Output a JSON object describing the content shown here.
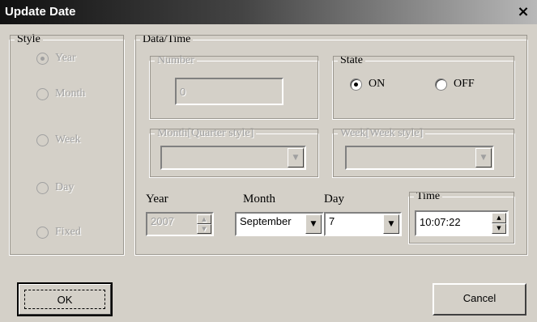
{
  "window": {
    "title": "Update Date",
    "close_glyph": "×"
  },
  "style_group": {
    "legend": "Style",
    "options": [
      {
        "label": "Year",
        "selected": true
      },
      {
        "label": "Month",
        "selected": false
      },
      {
        "label": "Week",
        "selected": false
      },
      {
        "label": "Day",
        "selected": false
      },
      {
        "label": "Fixed",
        "selected": false
      }
    ]
  },
  "datatime_group": {
    "legend": "Data/Time",
    "number": {
      "legend": "Number",
      "value": "0"
    },
    "state": {
      "legend": "State",
      "on_label": "ON",
      "off_label": "OFF",
      "selected": "ON"
    },
    "month_quarter": {
      "legend": "Month[Quarter style]",
      "value": ""
    },
    "week_style": {
      "legend": "Week[Week style]",
      "value": ""
    },
    "year": {
      "label": "Year",
      "value": "2007"
    },
    "month": {
      "label": "Month",
      "value": "September"
    },
    "day": {
      "label": "Day",
      "value": "7"
    },
    "time": {
      "legend": "Time",
      "value": "10:07:22"
    }
  },
  "buttons": {
    "ok_label": "OK",
    "cancel_label": "Cancel"
  },
  "icons": {
    "dropdown": "chevron-down-icon",
    "spin_up": "arrow-up-icon",
    "spin_down": "arrow-down-icon",
    "close": "close-icon"
  }
}
